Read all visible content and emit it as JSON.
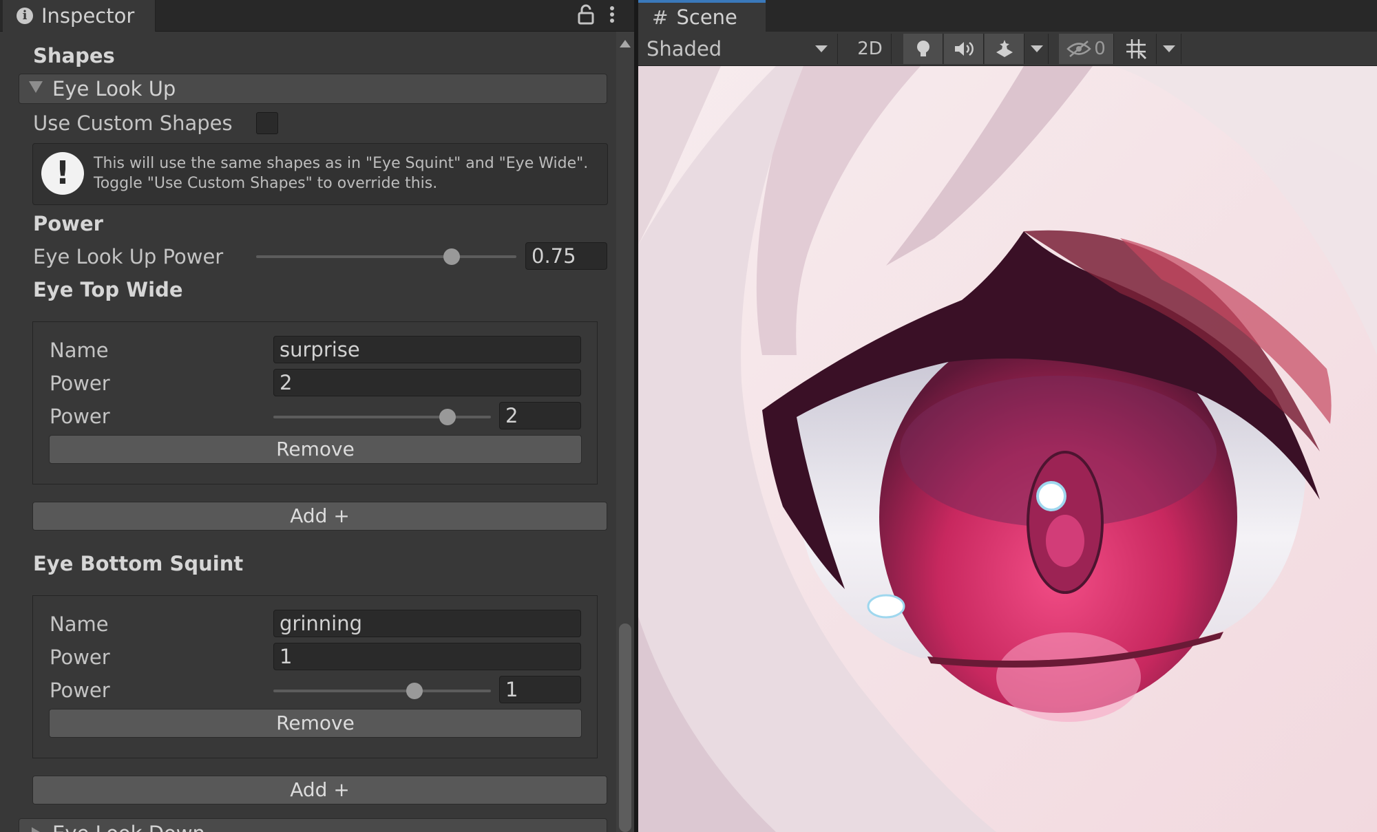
{
  "inspector": {
    "tab_label": "Inspector",
    "section_title": "Shapes",
    "foldout_label": "Eye Look Up",
    "use_custom_label": "Use Custom Shapes",
    "use_custom_checked": false,
    "help_line1": "This will use the same shapes as in \"Eye Squint\" and \"Eye Wide\".",
    "help_line2": "Toggle \"Use Custom Shapes\" to override this.",
    "power_header": "Power",
    "power_label": "Eye Look Up Power",
    "power_value": "0.75",
    "power_slider_fraction": 0.75,
    "eye_top_wide": {
      "title": "Eye Top Wide",
      "name_label": "Name",
      "name_value": "surprise",
      "power_label": "Power",
      "power_value": "2",
      "power_slider_label": "Power",
      "power_slider_value": "2",
      "power_slider_fraction": 0.8,
      "remove_label": "Remove",
      "add_label": "Add +"
    },
    "eye_bottom_squint": {
      "title": "Eye Bottom Squint",
      "name_label": "Name",
      "name_value": "grinning",
      "power_label": "Power",
      "power_value": "1",
      "power_slider_label": "Power",
      "power_slider_value": "1",
      "power_slider_fraction": 0.65,
      "remove_label": "Remove",
      "add_label": "Add +"
    },
    "next_foldout_label": "Eye Look Down"
  },
  "scene": {
    "tab_label": "Scene",
    "shading_mode": "Shaded",
    "mode_2d": "2D",
    "hidden_count": "0",
    "icons": [
      "lighting-icon",
      "audio-icon",
      "effects-icon",
      "visibility-icon",
      "grid-icon"
    ]
  },
  "colors": {
    "accent": "#3a79bb",
    "iris": "#c2285e",
    "iris_dark": "#5a1a35",
    "skin": "#f4e3e6",
    "hair": "#ddc8d0"
  }
}
